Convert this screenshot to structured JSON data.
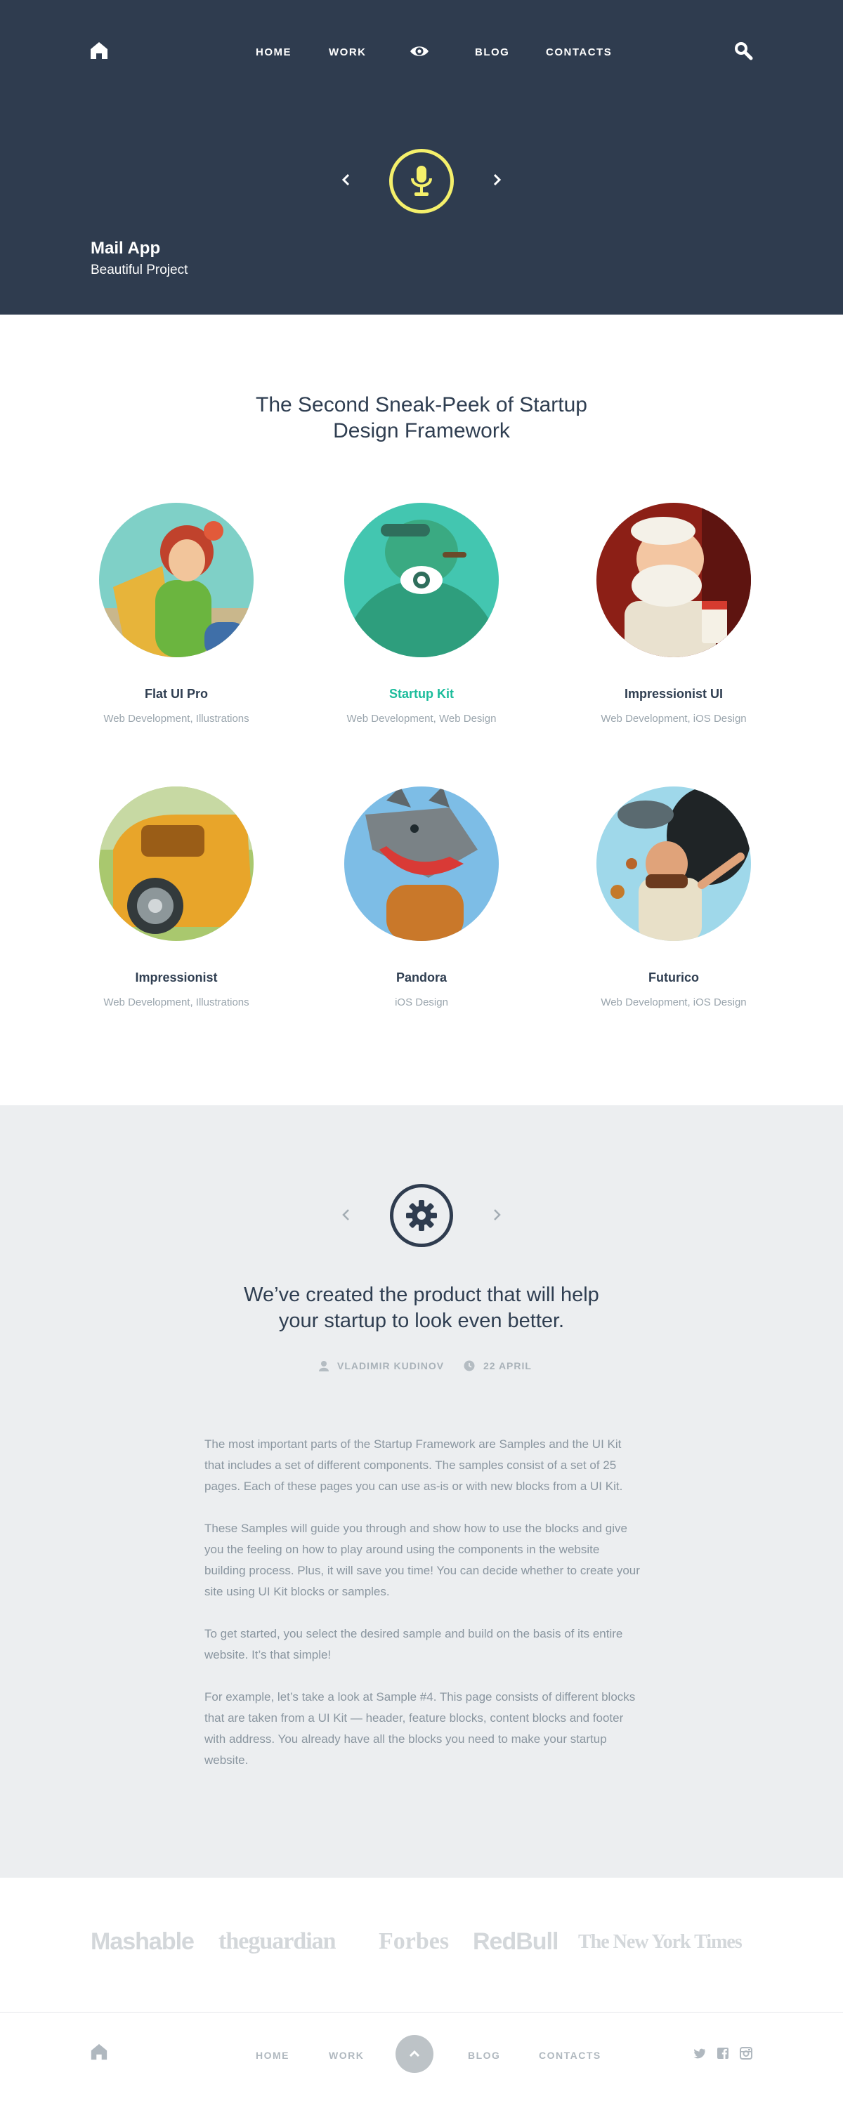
{
  "header": {
    "nav": {
      "home": "HOME",
      "work": "WORK",
      "blog": "BLOG",
      "contacts": "CONTACTS"
    },
    "icons": {
      "home": "home-icon",
      "eye": "eye-icon",
      "search": "search-icon",
      "prev": "chevron-left-icon",
      "next": "chevron-right-icon",
      "center": "microphone-icon"
    },
    "accent_color": "#f5f06b",
    "background": "#2f3c4f"
  },
  "hero": {
    "title": "Mail App",
    "subtitle": "Beautiful Project"
  },
  "projects": {
    "heading_line1": "The Second Sneak-Peek of Startup",
    "heading_line2": "Design Framework",
    "items": [
      {
        "name": "Flat UI Pro",
        "tags": "Web Development, Illustrations",
        "highlighted": false
      },
      {
        "name": "Startup Kit",
        "tags": "Web Development, Web Design",
        "highlighted": true
      },
      {
        "name": "Impressionist UI",
        "tags": "Web Development, iOS Design",
        "highlighted": false
      },
      {
        "name": "Impressionist",
        "tags": "Web Development, Illustrations",
        "highlighted": false
      },
      {
        "name": "Pandora",
        "tags": "iOS Design",
        "highlighted": false
      },
      {
        "name": "Futurico",
        "tags": "Web Development, iOS Design",
        "highlighted": false
      }
    ],
    "highlight_color": "#1bbc9b"
  },
  "article": {
    "title_line1": "We’ve created the product that will help",
    "title_line2": "your startup to look even better.",
    "author": "VLADIMIR KUDINOV",
    "date": "22 APRIL",
    "icons": {
      "center": "gear-icon",
      "author": "user-icon",
      "date": "clock-icon"
    },
    "paragraphs": [
      "The most important parts of the Startup Framework are Samples and the UI Kit that includes a set of different components. The samples consist of a set of 25 pages. Each of these pages you can use as-is or with new blocks from a UI Kit.",
      "These Samples will guide you through and show how to use the blocks and give you the feeling on how to play around using the components in the website building process. Plus, it will save you time! You can decide whether to create your site using UI Kit blocks or samples.",
      "To get started, you select the desired sample and build on the basis of its entire website. It’s that simple!",
      "For example, let’s take a look at Sample #4. This page consists of different blocks that are taken from a UI Kit — header, feature blocks, content blocks and footer with address. You already have all the blocks you need to make your startup website."
    ]
  },
  "press": {
    "logos": [
      "Mashable",
      "theguardian",
      "Forbes",
      "RedBull",
      "The New York Times"
    ]
  },
  "footer": {
    "nav": {
      "home": "HOME",
      "work": "WORK",
      "blog": "BLOG",
      "contacts": "CONTACTS"
    },
    "icons": {
      "home": "home-icon",
      "top": "chevron-up-icon",
      "twitter": "twitter-icon",
      "facebook": "facebook-icon",
      "instagram": "instagram-icon"
    }
  }
}
